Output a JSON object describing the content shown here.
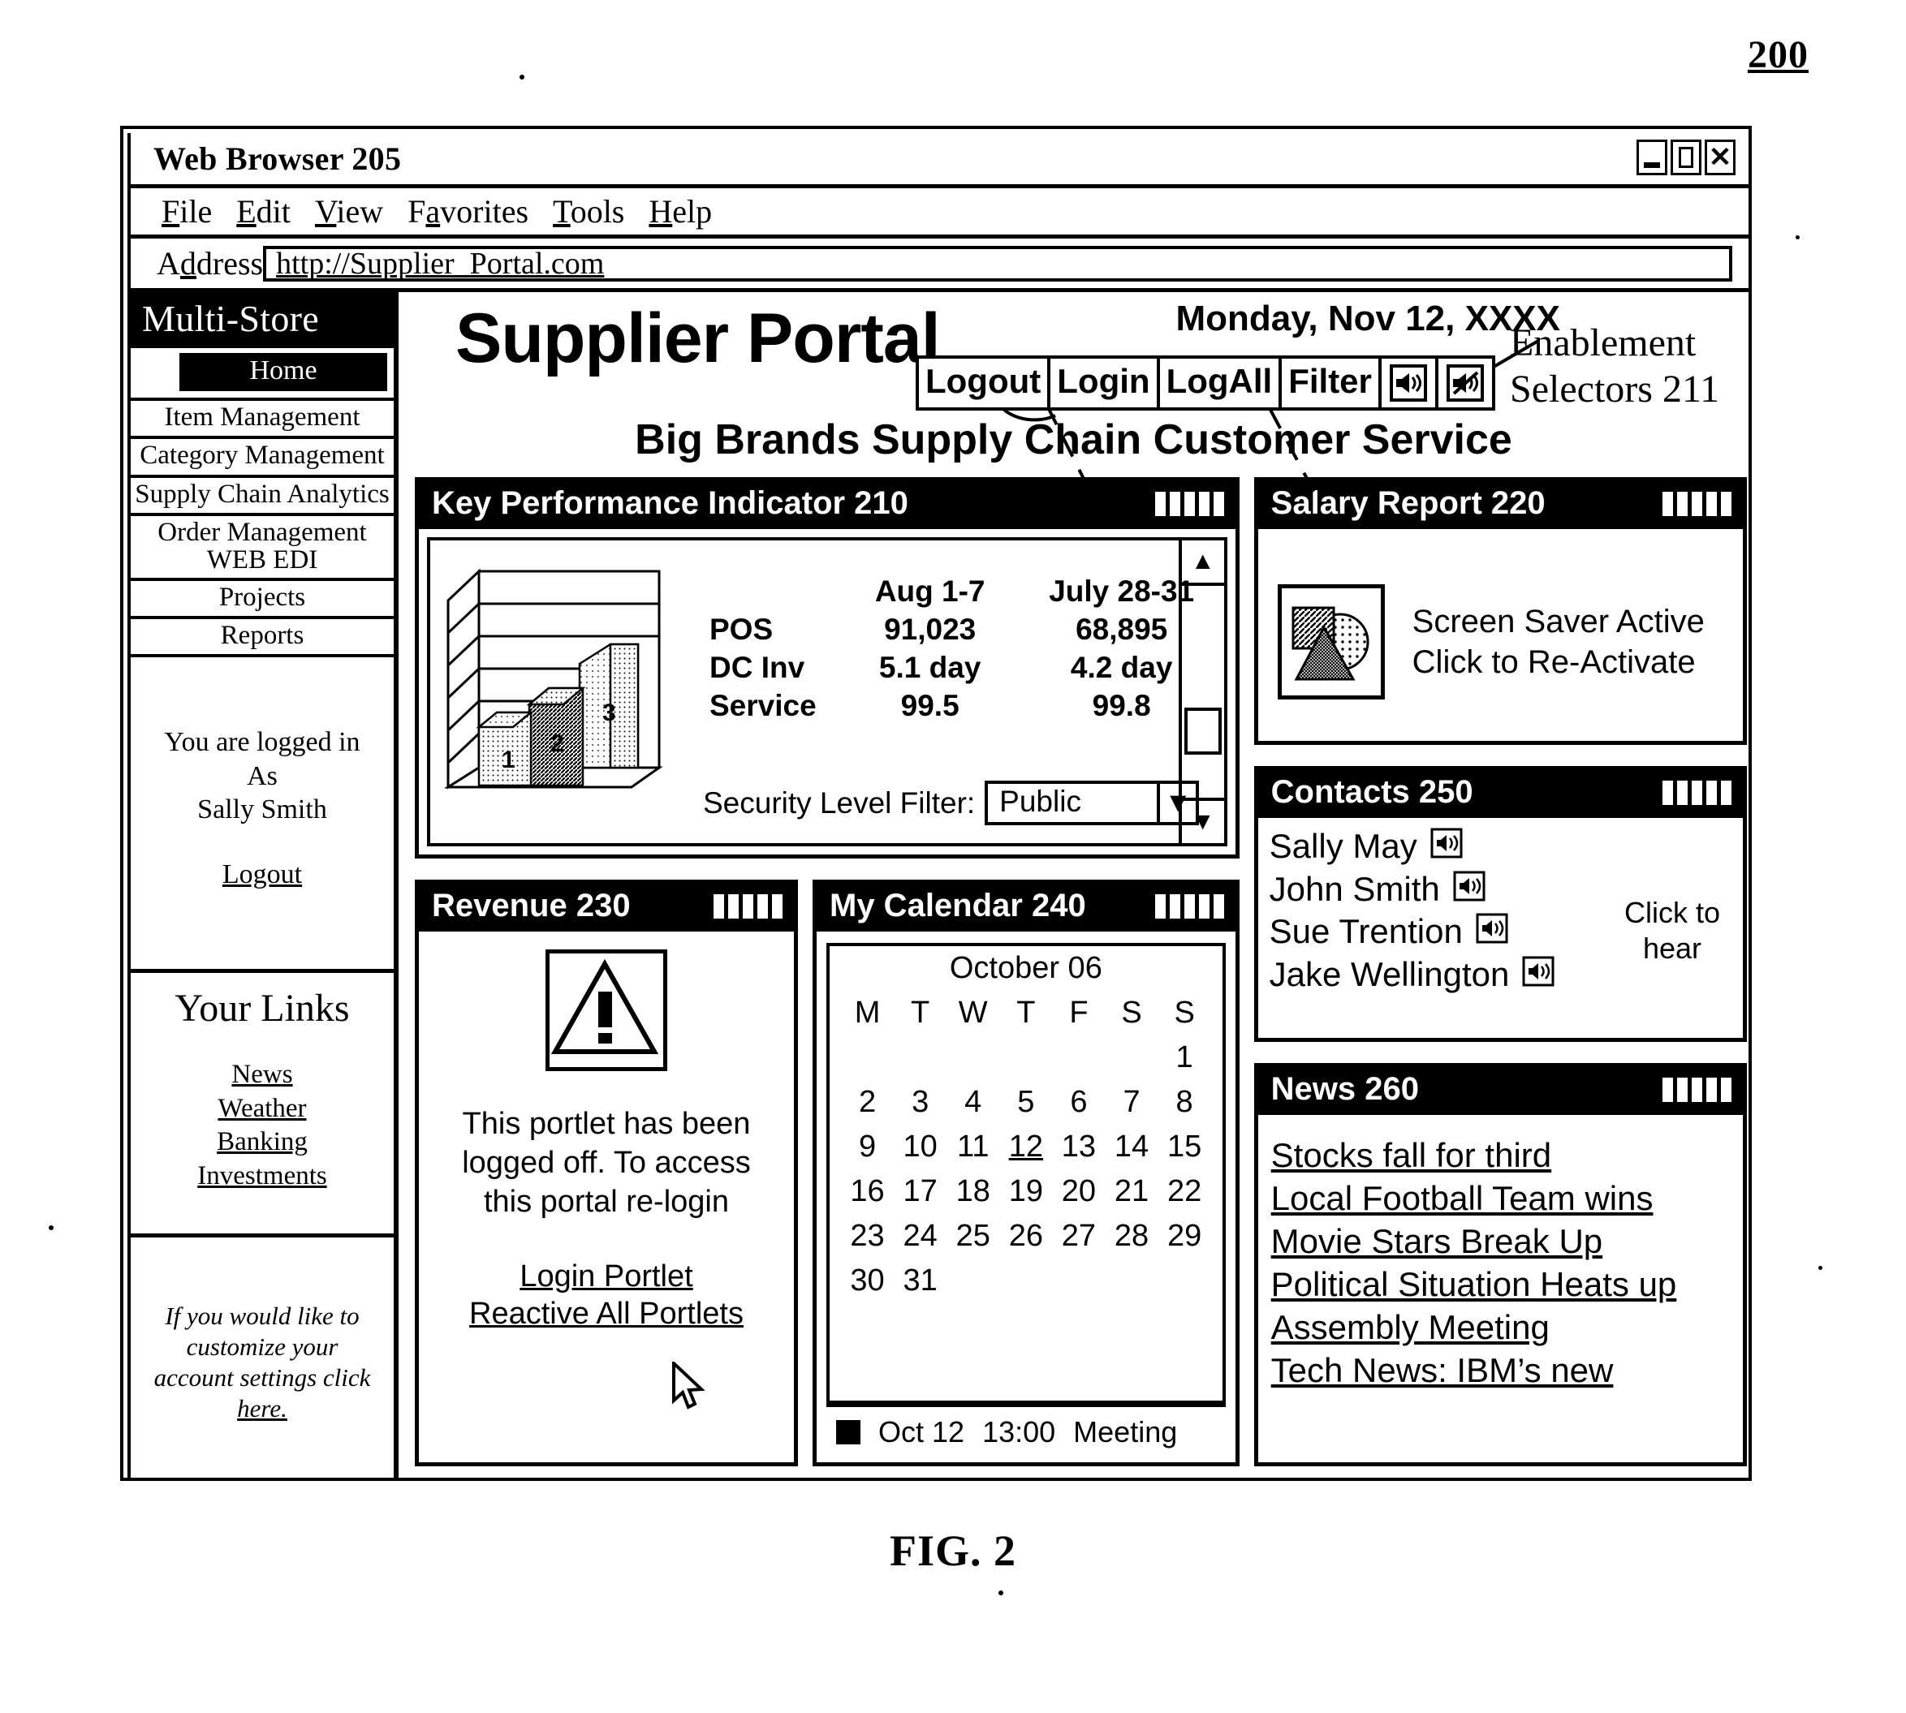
{
  "figure": {
    "number": "200",
    "caption": "FIG. 2",
    "annotation_line1": "Enablement",
    "annotation_line2": "Selectors 211"
  },
  "browser": {
    "title": "Web Browser 205",
    "window_controls": [
      "minimize",
      "maximize",
      "close"
    ],
    "menu": [
      "File",
      "Edit",
      "View",
      "Favorites",
      "Tools",
      "Help"
    ],
    "address_label": "Address",
    "address_value": "http://Supplier_Portal.com"
  },
  "sidebar": {
    "brand": "Multi-Store",
    "home": "Home",
    "nav_items": [
      "Item Management",
      "Category Management",
      "Supply Chain Analytics",
      "Order Management\nWEB EDI",
      "Projects",
      "Reports"
    ],
    "nav_order_line1": "Order Management",
    "nav_order_line2": "WEB EDI",
    "user": {
      "line1": "You are logged in",
      "line2": "As",
      "line3": "Sally Smith",
      "logout": "Logout"
    },
    "links_title": "Your Links",
    "links": [
      "News",
      "Weather",
      "Banking",
      "Investments"
    ],
    "customize": {
      "line1": "If you would like to",
      "line2": "customize your",
      "line3": "account settings click",
      "line4": "here."
    }
  },
  "portal": {
    "title": "Supplier Portal",
    "date": "Monday, Nov 12, XXXX",
    "subtitle": "Big Brands Supply Chain Customer Service",
    "selectors": [
      "Logout",
      "Login",
      "LogAll",
      "Filter"
    ],
    "selector_icons": [
      "speaker-on-icon",
      "speaker-muted-icon"
    ]
  },
  "kpi": {
    "title": "Key Performance Indicator 210",
    "columns": [
      "",
      "Aug 1-7",
      "July 28-31"
    ],
    "rows": [
      {
        "label": "POS",
        "aug": "91,023",
        "july": "68,895"
      },
      {
        "label": "DC Inv",
        "aug": "5.1 day",
        "july": "4.2 day"
      },
      {
        "label": "Service",
        "aug": "99.5",
        "july": "99.8"
      }
    ],
    "filter_label": "Security Level Filter:",
    "filter_value": "Public"
  },
  "chart_data": {
    "type": "bar",
    "title": "Key Performance Indicator 210",
    "categories": [
      "1",
      "2",
      "3"
    ],
    "values": [
      1,
      2,
      3.3
    ],
    "bar_labels": [
      "1",
      "2",
      "3"
    ],
    "xlabel": "",
    "ylabel": "",
    "ylim": [
      0,
      6
    ],
    "gridlines": 6,
    "style": "3d-column",
    "legend": "none"
  },
  "revenue": {
    "title": "Revenue  230",
    "message_line1": "This portlet has been",
    "message_line2": "logged off. To access",
    "message_line3": "this portal re-login",
    "links": [
      "Login Portlet",
      "Reactive All Portlets"
    ],
    "icon": "warning-triangle-icon"
  },
  "calendar": {
    "title": "My Calendar 240",
    "month": "October 06",
    "day_headers": [
      "M",
      "T",
      "W",
      "T",
      "F",
      "S",
      "S"
    ],
    "weeks": [
      [
        "",
        "",
        "",
        "",
        "",
        "",
        "1"
      ],
      [
        "2",
        "3",
        "4",
        "5",
        "6",
        "7",
        "8"
      ],
      [
        "9",
        "10",
        "11",
        "12",
        "13",
        "14",
        "15"
      ],
      [
        "16",
        "17",
        "18",
        "19",
        "20",
        "21",
        "22"
      ],
      [
        "23",
        "24",
        "25",
        "26",
        "27",
        "28",
        "29"
      ],
      [
        "30",
        "31",
        "",
        "",
        "",
        "",
        ""
      ]
    ],
    "today": "12",
    "event_date": "Oct 12",
    "event_time": "13:00",
    "event_title": "Meeting"
  },
  "salary": {
    "title": "Salary Report 220",
    "line1": "Screen Saver Active",
    "line2": "Click to Re-Activate",
    "icon": "screensaver-shapes-icon"
  },
  "contacts": {
    "title": "Contacts 250",
    "names": [
      "Sally May",
      "John Smith",
      "Sue Trention",
      "Jake Wellington"
    ],
    "hint_line1": "Click to",
    "hint_line2": "hear",
    "row_icon": "speaker-icon"
  },
  "news": {
    "title": "News 260",
    "items": [
      "Stocks fall for third",
      "Local Football Team wins",
      "Movie Stars Break Up",
      "Political Situation Heats up",
      "Assembly Meeting",
      "Tech News: IBM’s new"
    ]
  },
  "colors": {
    "ink": "#000000",
    "paper": "#ffffff"
  }
}
